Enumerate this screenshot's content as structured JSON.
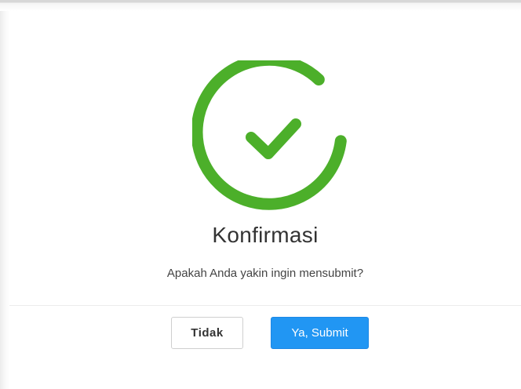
{
  "dialog": {
    "title": "Konfirmasi",
    "message": "Apakah Anda yakin ingin mensubmit?",
    "icon": "success-check-icon",
    "accent_color": "#4caf2a",
    "buttons": {
      "cancel_label": "Tidak",
      "confirm_label": "Ya, Submit",
      "confirm_color": "#2196f3"
    }
  }
}
